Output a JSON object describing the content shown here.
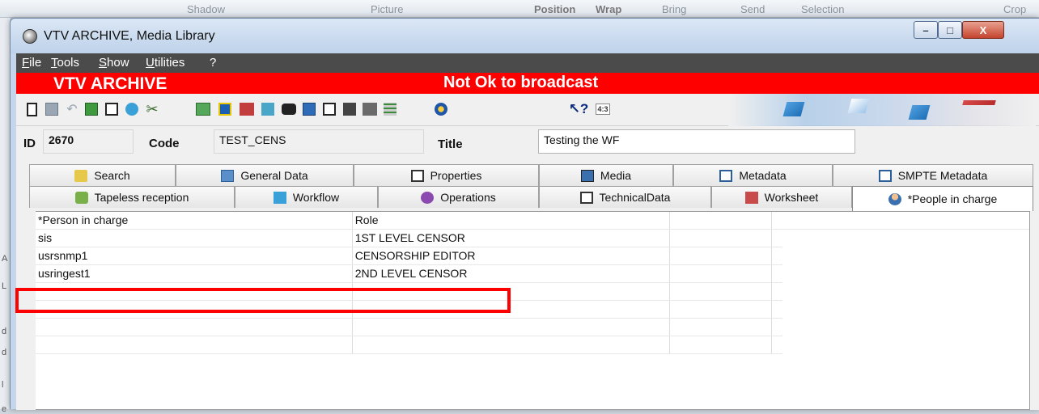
{
  "background_app": {
    "ribbon_items": [
      "Shadow",
      "Picture",
      "Position",
      "Wrap",
      "Bring",
      "Send",
      "Selection",
      "Crop"
    ],
    "left_letters": [
      "A",
      "L",
      "d",
      "d",
      "l",
      "e"
    ]
  },
  "window": {
    "title": "VTV ARCHIVE, Media Library",
    "controls": {
      "minimize": "–",
      "maximize": "□",
      "close": "X"
    }
  },
  "menu": [
    "File",
    "Tools",
    "Show",
    "Utilities",
    "?"
  ],
  "banner": {
    "app_name": "VTV ARCHIVE",
    "status": "Not Ok to broadcast",
    "color": "#ff0000"
  },
  "toolbar": {
    "icons": [
      "new-document-icon",
      "save-icon",
      "undo-icon",
      "refresh-icon",
      "copy-icon",
      "paste-icon",
      "scissors-icon",
      "metadata-icon",
      "film-icon",
      "network-icon",
      "import-icon",
      "binoculars-icon",
      "tree-icon",
      "preview-icon",
      "report-icon",
      "clapper-icon",
      "grid-icon",
      "play-icon",
      "help-cursor-icon",
      "aspect-ratio-icon"
    ],
    "aspect_label": "4:3"
  },
  "fields": {
    "id_label": "ID",
    "id_value": "2670",
    "code_label": "Code",
    "code_value": "TEST_CENS",
    "title_label": "Title",
    "title_value": "Testing the WF"
  },
  "tabs_row1": [
    "Search",
    "General Data",
    "Properties",
    "Media",
    "Metadata",
    "SMPTE Metadata"
  ],
  "tabs_row2": [
    "Tapeless reception",
    "Workflow",
    "Operations",
    "TechnicalData",
    "Worksheet",
    "*People in charge"
  ],
  "active_tab": "*People in charge",
  "grid": {
    "columns": [
      "*Person in charge",
      "Role",
      "",
      ""
    ],
    "rows": [
      [
        "sis",
        "1ST LEVEL CENSOR",
        "",
        ""
      ],
      [
        "usrsnmp1",
        "CENSORSHIP EDITOR",
        "",
        ""
      ],
      [
        "usringest1",
        "2ND LEVEL CENSOR",
        "",
        ""
      ],
      [
        "",
        "",
        "",
        ""
      ],
      [
        "",
        "",
        "",
        ""
      ],
      [
        "",
        "",
        "",
        ""
      ],
      [
        "",
        "",
        "",
        ""
      ]
    ],
    "highlighted_row": 1,
    "highlight_color": "#ff0000"
  }
}
